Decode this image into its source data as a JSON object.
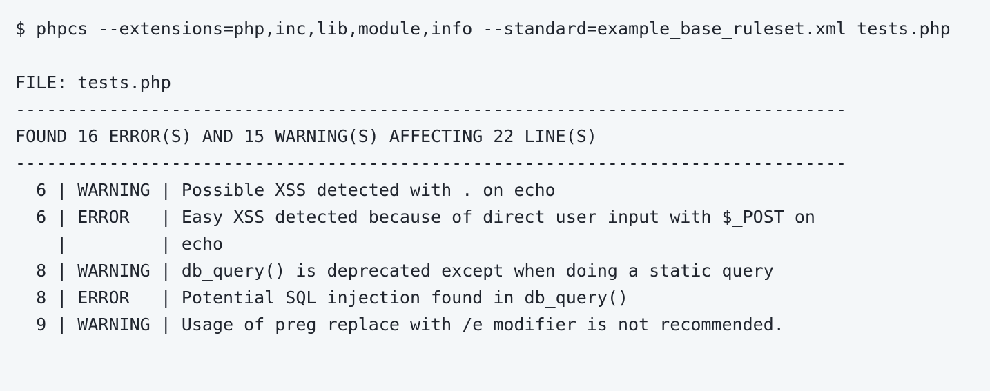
{
  "terminal": {
    "background_color": "#f4f7f9",
    "text_color": "#20252e",
    "prompt_symbol": "$",
    "command": "$ phpcs --extensions=php,inc,lib,module,info --standard=example_base_ruleset.xml tests.php",
    "file_header": "FILE: tests.php",
    "separator_top": "--------------------------------------------------------------------------------",
    "summary": "FOUND 16 ERROR(S) AND 15 WARNING(S) AFFECTING 22 LINE(S)",
    "separator_bottom": "--------------------------------------------------------------------------------",
    "summary_counts": {
      "errors": 16,
      "warnings": 15,
      "lines_affected": 22
    },
    "report_rows": [
      {
        "raw": "  6 | WARNING | Possible XSS detected with . on echo",
        "line": "6",
        "severity": "WARNING",
        "message": "Possible XSS detected with . on echo"
      },
      {
        "raw": "  6 | ERROR   | Easy XSS detected because of direct user input with $_POST on",
        "line": "6",
        "severity": "ERROR",
        "message": "Easy XSS detected because of direct user input with $_POST on"
      },
      {
        "raw": "    |         | echo",
        "line": "",
        "severity": "",
        "message": "echo"
      },
      {
        "raw": "  8 | WARNING | db_query() is deprecated except when doing a static query",
        "line": "8",
        "severity": "WARNING",
        "message": "db_query() is deprecated except when doing a static query"
      },
      {
        "raw": "  8 | ERROR   | Potential SQL injection found in db_query()",
        "line": "8",
        "severity": "ERROR",
        "message": "Potential SQL injection found in db_query()"
      },
      {
        "raw": "  9 | WARNING | Usage of preg_replace with /e modifier is not recommended.",
        "line": "9",
        "severity": "WARNING",
        "message": "Usage of preg_replace with /e modifier is not recommended."
      }
    ]
  }
}
